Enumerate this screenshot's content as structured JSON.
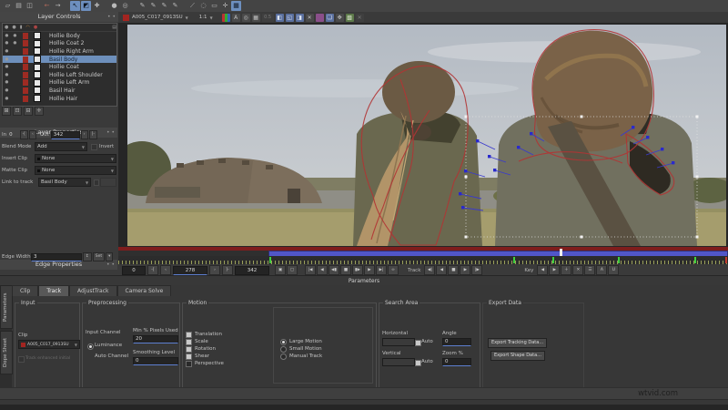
{
  "watermark": "wtvid.com",
  "top_toolbar": {
    "icons": [
      {
        "name": "new-project-icon",
        "glyph": "▱"
      },
      {
        "name": "open-project-icon",
        "glyph": "▤"
      },
      {
        "name": "save-project-icon",
        "glyph": "◫"
      },
      {
        "name": "sep"
      },
      {
        "name": "undo-icon",
        "glyph": "←",
        "cls": "red"
      },
      {
        "name": "redo-icon",
        "glyph": "→"
      },
      {
        "name": "sep"
      },
      {
        "name": "select-tool-icon",
        "glyph": "↖",
        "active": true
      },
      {
        "name": "marquee-select-tool-icon",
        "glyph": "◩",
        "active": true
      },
      {
        "name": "add-point-tool-icon",
        "glyph": "✚"
      },
      {
        "name": "sep"
      },
      {
        "name": "pan-tool-icon",
        "glyph": "●"
      },
      {
        "name": "zoom-tool-icon",
        "glyph": "◎"
      },
      {
        "name": "sep"
      },
      {
        "name": "create-xspline-tool-icon",
        "glyph": "✎"
      },
      {
        "name": "add-xspline-tool-icon",
        "glyph": "✎"
      },
      {
        "name": "create-bezier-tool-icon",
        "glyph": "✎"
      },
      {
        "name": "add-bezier-tool-icon",
        "glyph": "✎"
      },
      {
        "name": "sep"
      },
      {
        "name": "magnetic-spline-tool-icon",
        "glyph": "⟋"
      },
      {
        "name": "circle-spline-tool-icon",
        "glyph": "◌"
      },
      {
        "name": "rect-spline-tool-icon",
        "glyph": "▭"
      },
      {
        "name": "move-surface-tool-icon",
        "glyph": "✛"
      },
      {
        "name": "show-planar-grid-icon",
        "glyph": "▦",
        "active": true
      }
    ]
  },
  "layer_controls": {
    "title": "Layer Controls",
    "dots": "• •",
    "header_icons": [
      {
        "name": "visibility-column-icon",
        "glyph": "●"
      },
      {
        "name": "process-column-icon",
        "glyph": "●"
      },
      {
        "name": "lock-column-icon",
        "glyph": "▮"
      },
      {
        "name": "mask-column-icon",
        "glyph": "◠",
        "cls": "orange"
      },
      {
        "name": "color-column-icon",
        "glyph": "●",
        "cls": "redc"
      }
    ],
    "corner_icon": {
      "name": "layer-menu-icon",
      "glyph": "▤"
    },
    "layers": [
      {
        "label": "Hollie Body",
        "dot2": true
      },
      {
        "label": "Hollie Coat 2",
        "dot2": true
      },
      {
        "label": "Hollie Right Arm"
      },
      {
        "label": "Basil Body",
        "selected": true
      },
      {
        "label": "Hollie Coat"
      },
      {
        "label": "Hollie Left Shoulder"
      },
      {
        "label": "Hollie Left Arm"
      },
      {
        "label": "Basil Hair"
      },
      {
        "label": "Hollie Hair"
      }
    ],
    "footer_icons": [
      {
        "name": "new-layer-icon",
        "glyph": "⊞"
      },
      {
        "name": "duplicate-layer-icon",
        "glyph": "⊡"
      },
      {
        "name": "delete-layer-icon",
        "glyph": "⊟"
      },
      {
        "name": "expand-layers-icon",
        "glyph": "✛"
      }
    ]
  },
  "layer_properties": {
    "title": "Layer Properties",
    "dots": "• •",
    "in_label": "In",
    "in_value": "0",
    "out_label": "Out",
    "out_value": "342",
    "blend_mode_label": "Blend Mode",
    "blend_mode_value": "Add",
    "invert_label": "Invert",
    "insert_clip_label": "Insert Clip",
    "insert_clip_value": "None",
    "matte_clip_label": "Matte Clip",
    "matte_clip_value": "None",
    "link_label": "Link to track",
    "link_value": "Basil Body"
  },
  "edge_properties": {
    "title": "Edge Properties",
    "dots": "• •",
    "edge_width_label": "Edge Width",
    "edge_width_value": "3",
    "set_label": "Set"
  },
  "viewer_toolbar": {
    "clip_name": "A005_C017_0913SU",
    "zoom_level": "1:1",
    "proxy_scale": "0.5",
    "icons": [
      {
        "name": "color-channels-icon",
        "glyph": "",
        "cls": "rgb"
      },
      {
        "name": "alpha-channel-icon",
        "glyph": "A"
      },
      {
        "name": "zoom-viewer-icon",
        "glyph": "◎"
      },
      {
        "name": "grid-overlay-icon",
        "glyph": "▦"
      },
      {
        "name": "proxy-scale-label",
        "glyph": "0.5",
        "cls": "dim"
      },
      {
        "name": "split-view-icon",
        "glyph": "◧",
        "cls": "bluish"
      },
      {
        "name": "stabilize-view-icon",
        "glyph": "◱",
        "cls": "bluish"
      },
      {
        "name": "mask-view-icon",
        "glyph": "◨",
        "cls": "bluish"
      },
      {
        "name": "clip-x-icon",
        "glyph": "✕"
      },
      {
        "name": "overlay-color-swatch-icon",
        "glyph": "",
        "cls": "purple"
      },
      {
        "name": "show-layers-icon",
        "glyph": "❏",
        "cls": "bluish"
      },
      {
        "name": "hand-pan-icon",
        "glyph": "✥"
      },
      {
        "name": "trace-icon",
        "glyph": "▧",
        "cls": "greenish"
      },
      {
        "name": "close-view-icon",
        "glyph": "✕",
        "cls": "dim"
      }
    ]
  },
  "timeline": {
    "in_value": "0",
    "current_frame": "278",
    "out_value": "342",
    "range": [
      0.246,
      1.0
    ],
    "playhead": 0.724,
    "keyframes": [
      0.248,
      0.648,
      0.712,
      0.819,
      0.945
    ],
    "end_marker": 0.995,
    "zoom_buttons": [
      {
        "name": "zoom-timeline-in-icon",
        "glyph": "▣"
      },
      {
        "name": "zoom-timeline-out-icon",
        "glyph": "▢"
      }
    ],
    "transport_buttons": [
      {
        "name": "jump-start-button",
        "glyph": "|◀"
      },
      {
        "name": "play-reverse-button",
        "glyph": "◀"
      },
      {
        "name": "step-back-button",
        "glyph": "◀▮"
      },
      {
        "name": "stop-button",
        "glyph": "■"
      },
      {
        "name": "step-forward-button",
        "glyph": "▮▶"
      },
      {
        "name": "play-button",
        "glyph": "▶"
      },
      {
        "name": "jump-end-button",
        "glyph": "▶|"
      },
      {
        "name": "loop-button",
        "glyph": "∞"
      }
    ],
    "track_label": "Track",
    "track_buttons": [
      {
        "name": "track-backwards-button",
        "glyph": "◀|"
      },
      {
        "name": "track-back-one-button",
        "glyph": "◀"
      },
      {
        "name": "track-stop-button",
        "glyph": "■"
      },
      {
        "name": "track-fwd-one-button",
        "glyph": "▶"
      },
      {
        "name": "track-forwards-button",
        "glyph": "|▶"
      }
    ],
    "key_label": "Key",
    "key_buttons": [
      {
        "name": "prev-key-button",
        "glyph": "◀"
      },
      {
        "name": "next-key-button",
        "glyph": "▶"
      },
      {
        "name": "add-key-button",
        "glyph": "＋"
      },
      {
        "name": "delete-key-button",
        "glyph": "✕"
      },
      {
        "name": "key-menu-button",
        "glyph": "☰"
      },
      {
        "name": "autokey-button",
        "glyph": "A"
      },
      {
        "name": "uberkey-button",
        "glyph": "U"
      }
    ]
  },
  "parameters_bar": {
    "label": "Parameters"
  },
  "bottom_panel": {
    "side_tabs": [
      {
        "label": "Parameters"
      },
      {
        "label": "Dope Sheet"
      }
    ],
    "tabs": [
      {
        "label": "Clip"
      },
      {
        "label": "Track",
        "active": true
      },
      {
        "label": "AdjustTrack"
      },
      {
        "label": "Camera Solve"
      }
    ],
    "input": {
      "title": "Input",
      "clip_label": "Clip",
      "clip_value": "A005_C017_0913SU",
      "checkbox_label": "Track enhanced initial"
    },
    "preprocessing": {
      "title": "Preprocessing",
      "input_channel_label": "Input Channel",
      "luminance_label": "Luminance",
      "auto_channel_label": "Auto Channel",
      "min_pixels_label": "Min % Pixels Used",
      "min_pixels_value": "20",
      "smoothing_label": "Smoothing Level",
      "smoothing_value": "0"
    },
    "motion": {
      "title": "Motion",
      "checkboxes": [
        {
          "label": "Translation",
          "checked": true
        },
        {
          "label": "Scale",
          "checked": true
        },
        {
          "label": "Rotation",
          "checked": true
        },
        {
          "label": "Shear",
          "checked": true
        },
        {
          "label": "Perspective",
          "checked": false
        }
      ],
      "radios": [
        {
          "label": "Large Motion",
          "selected": true
        },
        {
          "label": "Small Motion",
          "selected": false
        },
        {
          "label": "Manual Track",
          "selected": false
        }
      ]
    },
    "search_area": {
      "title": "Search Area",
      "horizontal_label": "Horizontal",
      "vertical_label": "Vertical",
      "auto_label": "Auto",
      "angle_label": "Angle",
      "angle_value": "0",
      "zoom_label": "Zoom %",
      "zoom_value": "0"
    },
    "export_data": {
      "title": "Export Data",
      "buttons": [
        {
          "label": "Export Tracking Data...",
          "name": "export-tracking-data-button"
        },
        {
          "label": "Export Shape Data...",
          "name": "export-shape-data-button"
        }
      ]
    }
  }
}
